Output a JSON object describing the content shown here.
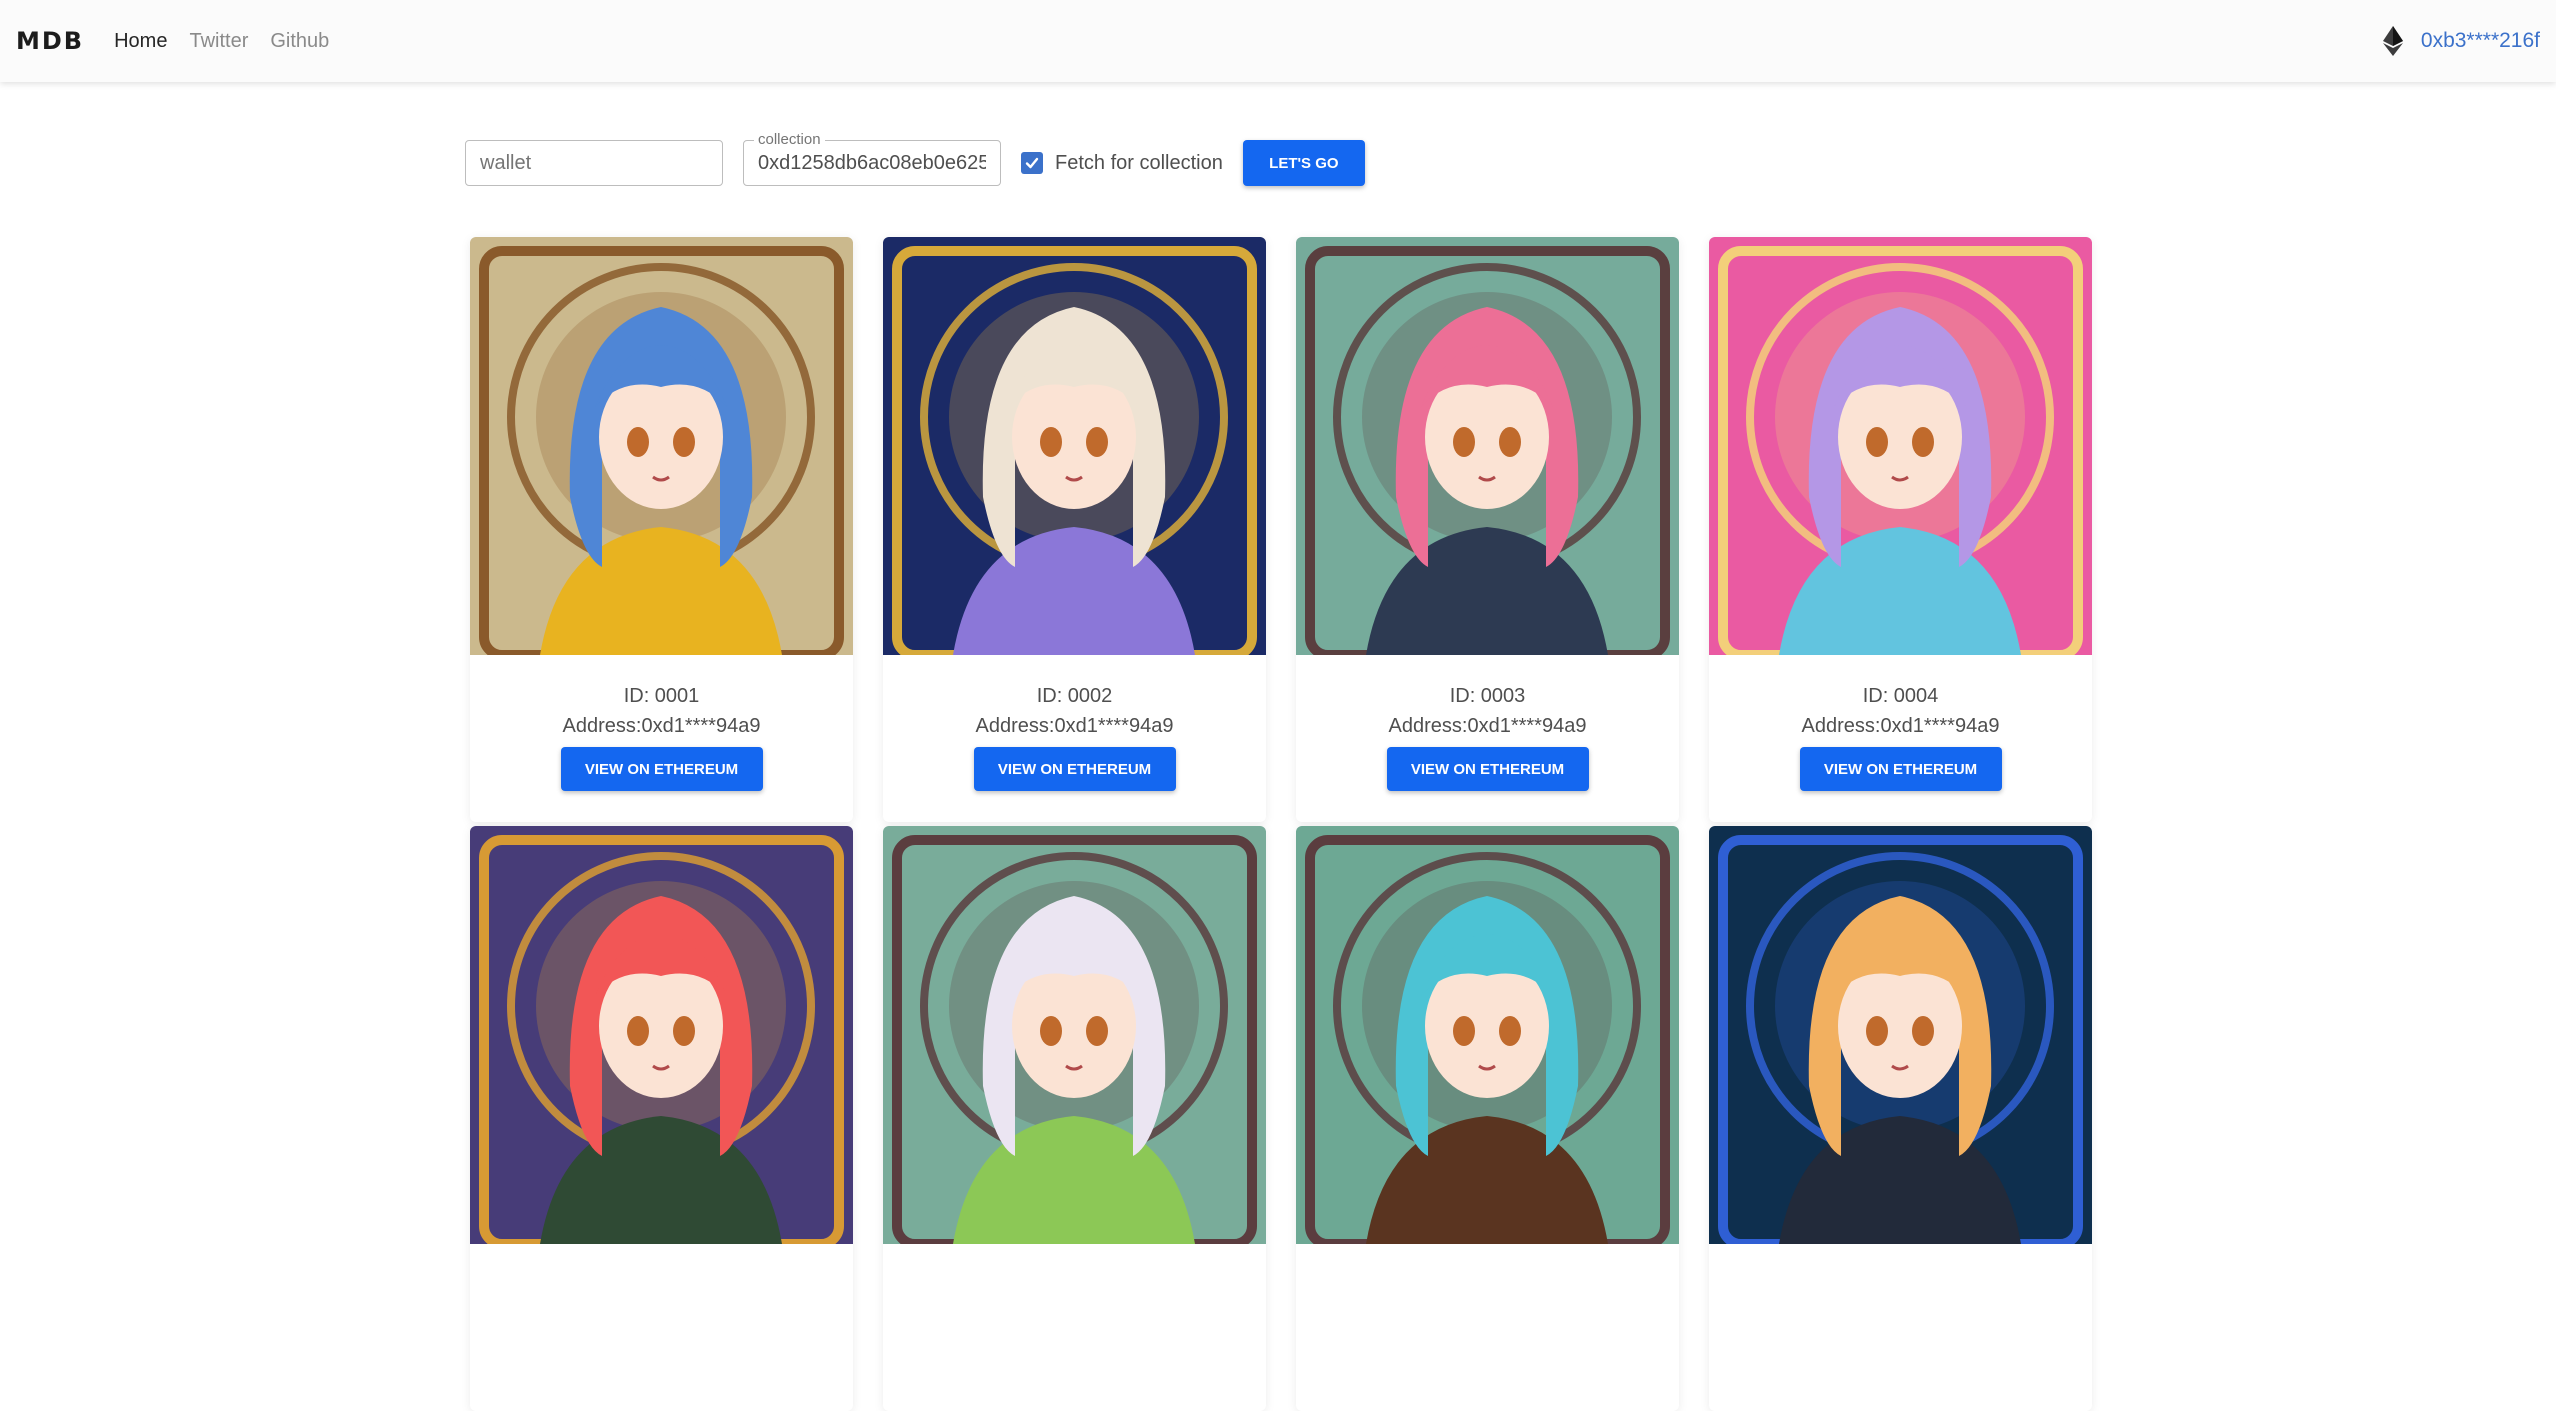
{
  "nav": {
    "brand": "MDB",
    "links": [
      "Home",
      "Twitter",
      "Github"
    ],
    "wallet": "0xb3****216f"
  },
  "search": {
    "wallet_placeholder": "wallet",
    "collection_label": "collection",
    "collection_value": "0xd1258db6ac08eb0e625",
    "fetch_label": "Fetch for collection",
    "fetch_checked": true,
    "go_label": "LET'S GO"
  },
  "colors": {
    "accent": "#1467f0",
    "link": "#3b71ca"
  },
  "cards": [
    {
      "id": "ID: 0001",
      "address": "Address:0xd1****94a9",
      "button": "VIEW ON ETHEREUM",
      "art": {
        "bg": "#cbb98d",
        "frame": "#8a5a2b",
        "hair": "#4f86d6",
        "outfit": "#e8b320"
      }
    },
    {
      "id": "ID: 0002",
      "address": "Address:0xd1****94a9",
      "button": "VIEW ON ETHEREUM",
      "art": {
        "bg": "#1b2a66",
        "frame": "#d6a93a",
        "hair": "#eee3d3",
        "outfit": "#8b77d8"
      }
    },
    {
      "id": "ID: 0003",
      "address": "Address:0xd1****94a9",
      "button": "VIEW ON ETHEREUM",
      "art": {
        "bg": "#76ab9b",
        "frame": "#5a3f3f",
        "hair": "#ec6f96",
        "outfit": "#2d3a52"
      }
    },
    {
      "id": "ID: 0004",
      "address": "Address:0xd1****94a9",
      "button": "VIEW ON ETHEREUM",
      "art": {
        "bg": "#ea5aa2",
        "frame": "#f3cf7a",
        "hair": "#b497e6",
        "outfit": "#62c4df"
      }
    },
    {
      "id": "",
      "address": "",
      "button": "",
      "art": {
        "bg": "#473c78",
        "frame": "#d79a34",
        "hair": "#f25656",
        "outfit": "#2f4a34"
      }
    },
    {
      "id": "",
      "address": "",
      "button": "",
      "art": {
        "bg": "#79ac9a",
        "frame": "#5b3d3f",
        "hair": "#ebe5f2",
        "outfit": "#8cc856"
      }
    },
    {
      "id": "",
      "address": "",
      "button": "",
      "art": {
        "bg": "#6da894",
        "frame": "#5b3d3f",
        "hair": "#4cc3d4",
        "outfit": "#5a3420"
      }
    },
    {
      "id": "",
      "address": "",
      "button": "",
      "art": {
        "bg": "#0e2f4e",
        "frame": "#2f5fd4",
        "hair": "#f2b060",
        "outfit": "#222a3a"
      }
    }
  ]
}
